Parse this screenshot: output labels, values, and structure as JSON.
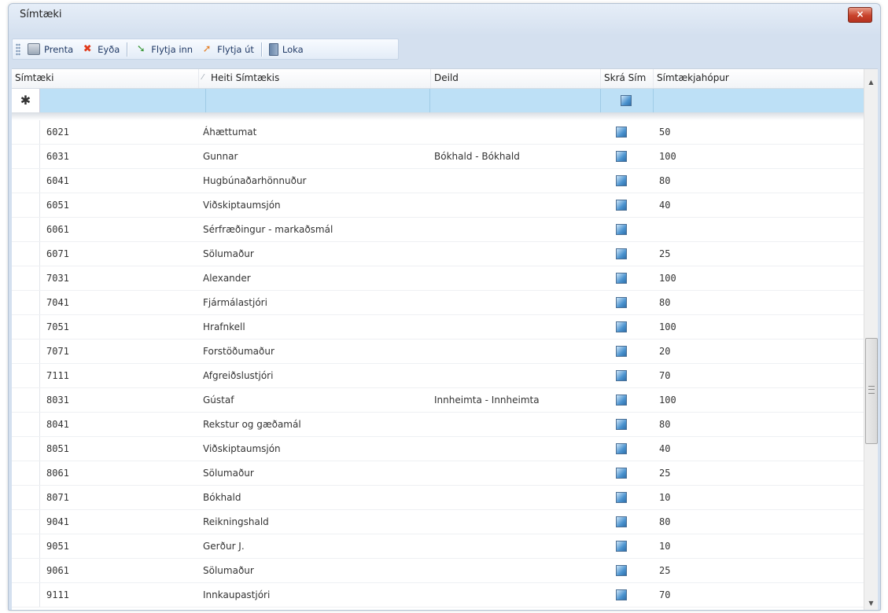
{
  "window": {
    "title": "Símtæki",
    "close_label": "×"
  },
  "toolbar": {
    "buttons": [
      {
        "label": "Prenta",
        "icon": "printer-icon"
      },
      {
        "label": "Eyða",
        "icon": "delete-icon"
      },
      {
        "label": "Flytja inn",
        "icon": "import-icon"
      },
      {
        "label": "Flytja út",
        "icon": "export-icon"
      },
      {
        "label": "Loka",
        "icon": "exit-icon"
      }
    ]
  },
  "grid": {
    "columns": [
      "Símtæki",
      "Heiti Símtækis",
      "Deild",
      "Skrá Sím",
      "Símtækjahópur"
    ],
    "new_row_marker": "✱",
    "rows": [
      {
        "simtaeki": "6021",
        "heiti": "Áhættumat",
        "deild": "",
        "skra_sim": true,
        "hopur": "50"
      },
      {
        "simtaeki": "6031",
        "heiti": "Gunnar",
        "deild": "Bókhald - Bókhald",
        "skra_sim": true,
        "hopur": "100"
      },
      {
        "simtaeki": "6041",
        "heiti": "Hugbúnaðarhönnuður",
        "deild": "",
        "skra_sim": true,
        "hopur": "80"
      },
      {
        "simtaeki": "6051",
        "heiti": "Viðskiptaumsjón",
        "deild": "",
        "skra_sim": true,
        "hopur": "40"
      },
      {
        "simtaeki": "6061",
        "heiti": "Sérfræðingur - markaðsmál",
        "deild": "",
        "skra_sim": true,
        "hopur": ""
      },
      {
        "simtaeki": "6071",
        "heiti": "Sölumaður",
        "deild": "",
        "skra_sim": true,
        "hopur": "25"
      },
      {
        "simtaeki": "7031",
        "heiti": "Alexander",
        "deild": "",
        "skra_sim": true,
        "hopur": "100"
      },
      {
        "simtaeki": "7041",
        "heiti": "Fjármálastjóri",
        "deild": "",
        "skra_sim": true,
        "hopur": "80"
      },
      {
        "simtaeki": "7051",
        "heiti": "Hrafnkell",
        "deild": "",
        "skra_sim": true,
        "hopur": "100"
      },
      {
        "simtaeki": "7071",
        "heiti": "Forstöðumaður",
        "deild": "",
        "skra_sim": true,
        "hopur": "20"
      },
      {
        "simtaeki": "7111",
        "heiti": "Afgreiðslustjóri",
        "deild": "",
        "skra_sim": true,
        "hopur": "70"
      },
      {
        "simtaeki": "8031",
        "heiti": "Gústaf",
        "deild": "Innheimta - Innheimta",
        "skra_sim": true,
        "hopur": "100"
      },
      {
        "simtaeki": "8041",
        "heiti": "Rekstur og gæðamál",
        "deild": "",
        "skra_sim": true,
        "hopur": "80"
      },
      {
        "simtaeki": "8051",
        "heiti": "Viðskiptaumsjón",
        "deild": "",
        "skra_sim": true,
        "hopur": "40"
      },
      {
        "simtaeki": "8061",
        "heiti": "Sölumaður",
        "deild": "",
        "skra_sim": true,
        "hopur": "25"
      },
      {
        "simtaeki": "8071",
        "heiti": "Bókhald",
        "deild": "",
        "skra_sim": true,
        "hopur": "10"
      },
      {
        "simtaeki": "9041",
        "heiti": "Reikningshald",
        "deild": "",
        "skra_sim": true,
        "hopur": "80"
      },
      {
        "simtaeki": "9051",
        "heiti": "Gerður J.",
        "deild": "",
        "skra_sim": true,
        "hopur": "10"
      },
      {
        "simtaeki": "9061",
        "heiti": "Sölumaður",
        "deild": "",
        "skra_sim": true,
        "hopur": "25"
      },
      {
        "simtaeki": "9111",
        "heiti": "Innkaupastjóri",
        "deild": "",
        "skra_sim": true,
        "hopur": "70"
      }
    ]
  }
}
